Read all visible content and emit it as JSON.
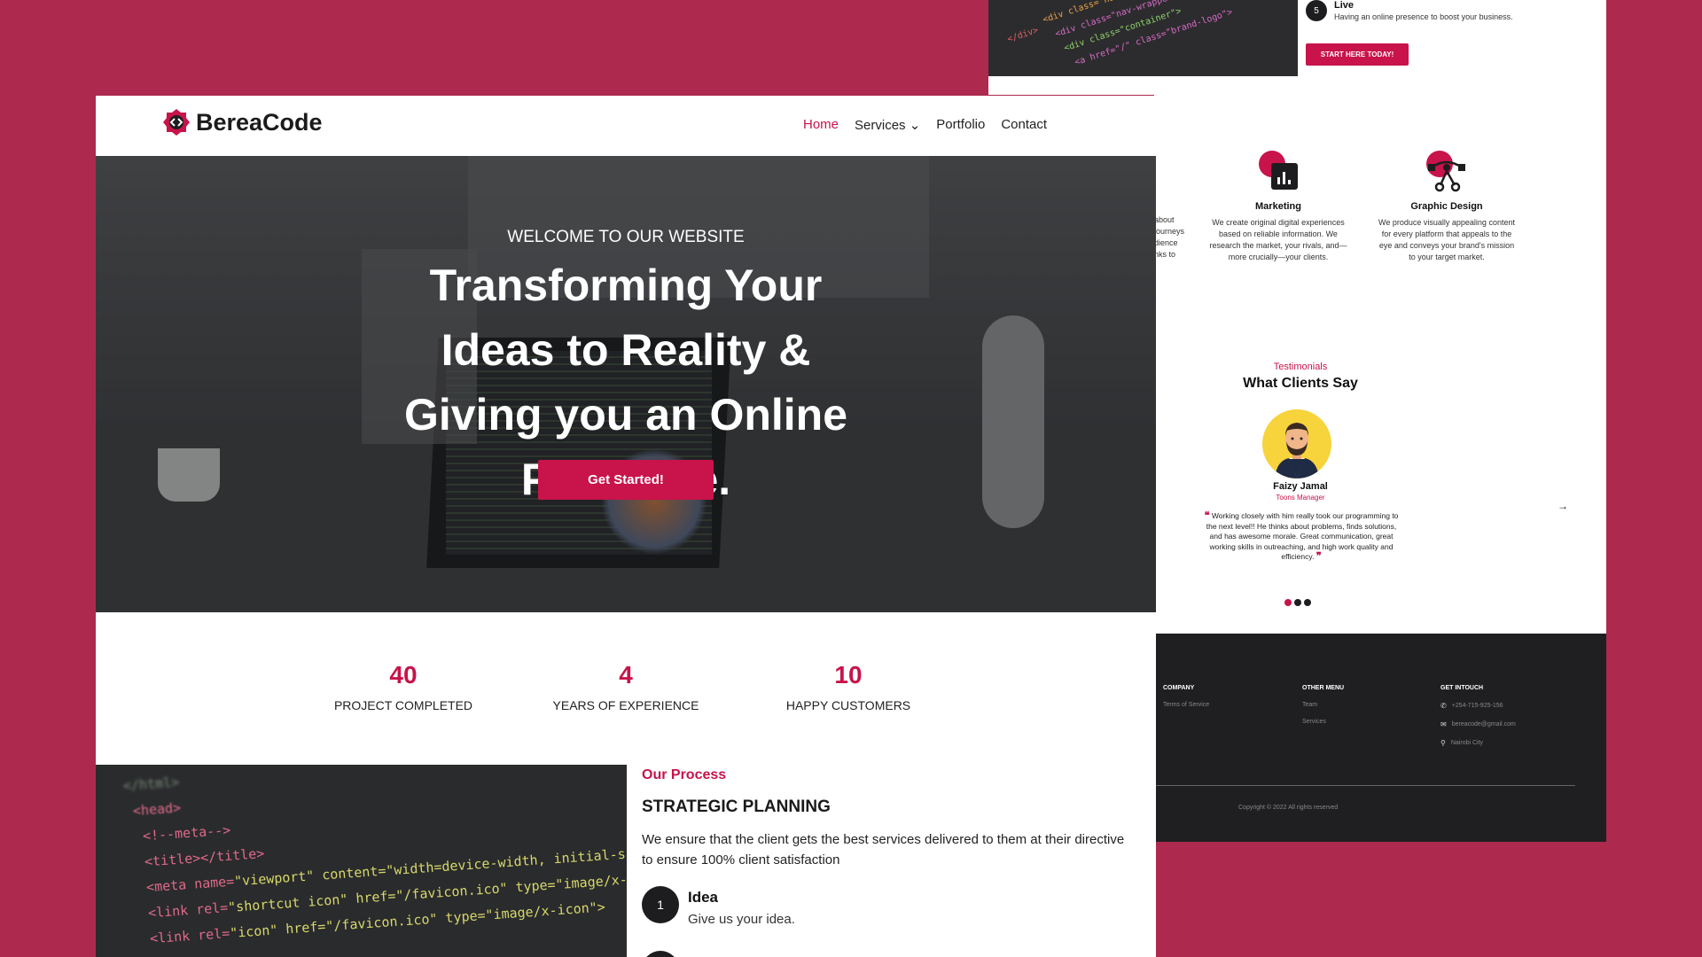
{
  "back_page": {
    "step5": {
      "number": "5",
      "title": "Live",
      "desc": "Having an online presence to boost your business."
    },
    "cta_label": "START HERE TODAY!",
    "partial_text": [
      "about",
      "journeys",
      "dience",
      "nks to"
    ],
    "services": [
      {
        "title": "Marketing",
        "desc": "We create original digital experiences based on reliable information. We research the market, your rivals, and—more crucially—your clients.",
        "icon": "chart-icon"
      },
      {
        "title": "Graphic Design",
        "desc": "We produce visually appealing content for every platform that appeals to the eye and conveys your brand's mission to your target market.",
        "icon": "vector-pen-icon"
      }
    ],
    "testimonials": {
      "label": "Testimonials",
      "title": "What Clients Say",
      "name": "Faizy Jamal",
      "role": "Toons Manager",
      "quote": "Working closely with him really took our programming to the next level!! He thinks about problems, finds solutions, and has awesome morale. Great communication, great working skills in outreaching, and high work quality and efficiency."
    },
    "footer": {
      "company": {
        "heading": "COMPANY",
        "items": [
          "Terms of Service"
        ]
      },
      "other_menu": {
        "heading": "OTHER MENU",
        "items": [
          "Team",
          "Services"
        ]
      },
      "contact": {
        "heading": "GET INTOUCH",
        "phone": "+254-715-925-156",
        "email": "bereacode@gmail.com",
        "location": "Nairobi City"
      },
      "copyright": "Copyright © 2022 All rights reserved"
    }
  },
  "front_page": {
    "brand": "BereaCode",
    "menu": {
      "home": "Home",
      "services": "Services",
      "portfolio": "Portfolio",
      "contact": "Contact"
    },
    "hero": {
      "welcome": "WELCOME TO OUR WEBSITE",
      "title": "Transforming Your Ideas to Reality & Giving you an Online Presence.",
      "button": "Get Started!"
    },
    "stats": [
      {
        "value": "40",
        "label": "PROJECT COMPLETED"
      },
      {
        "value": "4",
        "label": "YEARS OF EXPERIENCE"
      },
      {
        "value": "10",
        "label": "HAPPY CUSTOMERS"
      }
    ],
    "process": {
      "label": "Our Process",
      "title": "STRATEGIC PLANNING",
      "desc": "We ensure that the client gets the best services delivered to them at their directive to ensure 100% client satisfaction",
      "step1": {
        "number": "1",
        "title": "Idea",
        "desc": "Give us your idea."
      }
    }
  },
  "colors": {
    "accent": "#c8134b",
    "background": "#ad2a4e",
    "dark": "#1f1f21"
  }
}
